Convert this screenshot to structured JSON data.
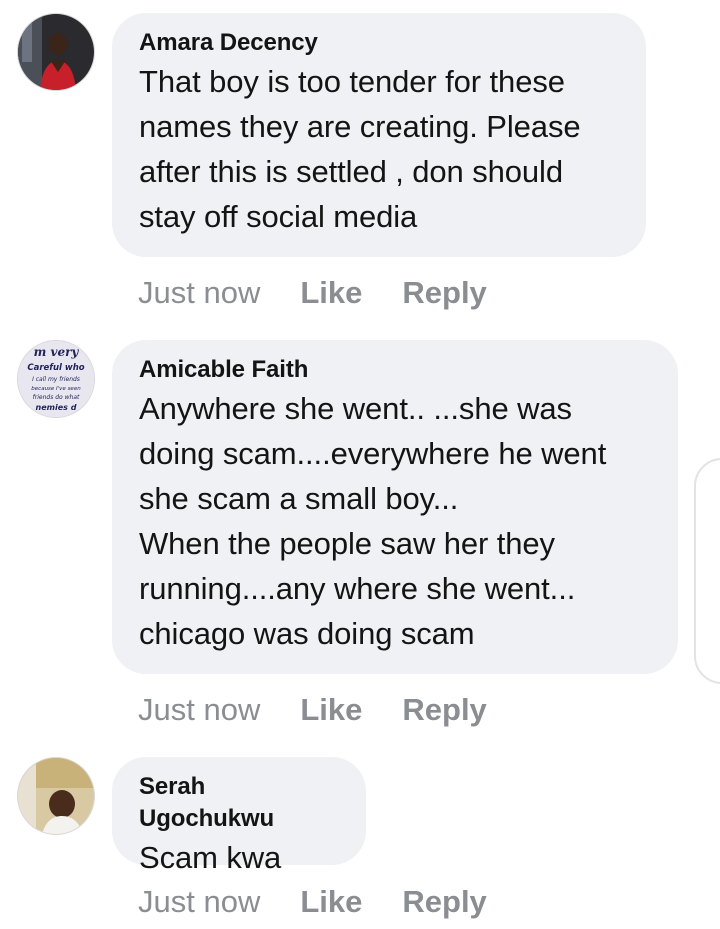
{
  "comments": [
    {
      "author": "Amara Decency",
      "text": "That boy is too tender for these\nnames they are creating. Please\nafter this is settled , don should\nstay off social media",
      "time": "Just now",
      "like_label": "Like",
      "reply_label": "Reply"
    },
    {
      "author": "Amicable Faith",
      "avatar_text": [
        "m very",
        "Careful who",
        "I call my friends",
        "because I've seen",
        "friends do what",
        "nemies d"
      ],
      "text": "Anywhere she went.. ...she was\ndoing scam....everywhere he went\nshe scam a small boy...\nWhen the people saw her they\nrunning....any where she went...\nchicago was doing scam",
      "time": "Just now",
      "like_label": "Like",
      "reply_label": "Reply"
    },
    {
      "author": "Serah Ugochukwu",
      "text": "Scam kwa",
      "time": "Just now",
      "like_label": "Like",
      "reply_label": "Reply"
    }
  ],
  "colors": {
    "bubble_bg": "#f0f1f5",
    "text": "#141414",
    "meta": "#8a8d91"
  }
}
